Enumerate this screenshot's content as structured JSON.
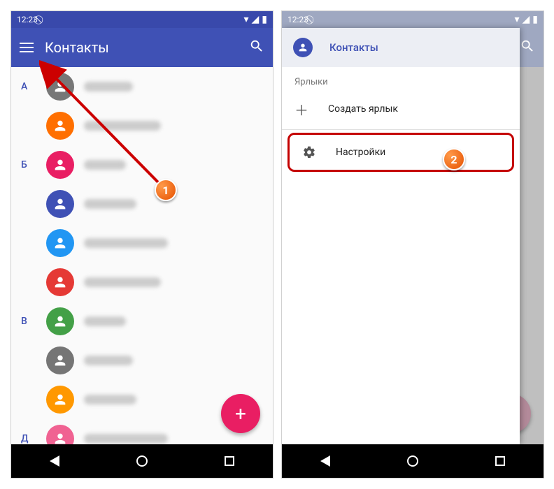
{
  "status": {
    "time": "12:23"
  },
  "appbar": {
    "title": "Контакты"
  },
  "sections": {
    "A": "А",
    "B": "Б",
    "V": "В",
    "D": "Д"
  },
  "contactColors": [
    "#777",
    "#ff6f00",
    "#e91e63",
    "#3f51b5",
    "#2196f3",
    "#e53935",
    "#43a047",
    "#757575",
    "#ff9800",
    "#f06292",
    "#bdbdbd"
  ],
  "drawer": {
    "title": "Контакты",
    "section": "Ярлыки",
    "create": "Создать ярлык",
    "settings": "Настройки"
  },
  "callouts": {
    "one": "1",
    "two": "2"
  }
}
